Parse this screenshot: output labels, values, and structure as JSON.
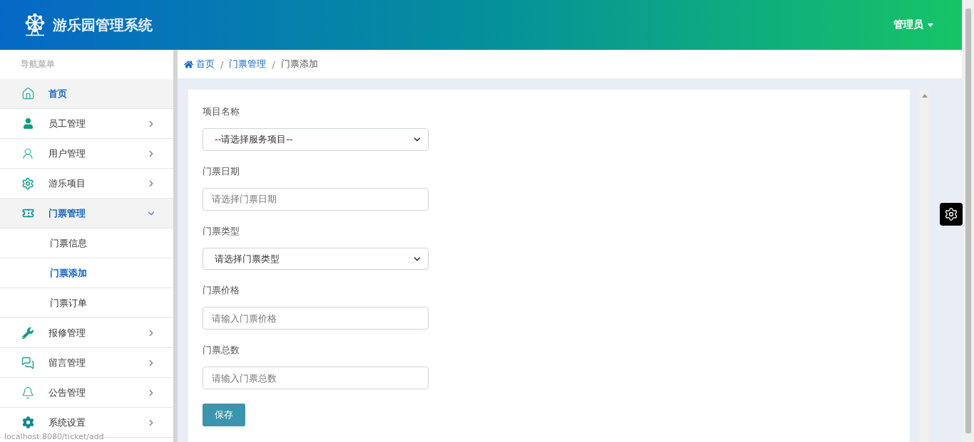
{
  "header": {
    "title": "游乐园管理系统",
    "user_menu": "管理员"
  },
  "sidebar": {
    "heading": "导航菜单",
    "items": [
      {
        "label": "首页",
        "selected": true,
        "expandable": false,
        "expanded": false
      },
      {
        "label": "员工管理",
        "selected": false,
        "expandable": true,
        "expanded": false
      },
      {
        "label": "用户管理",
        "selected": false,
        "expandable": true,
        "expanded": false
      },
      {
        "label": "游乐项目",
        "selected": false,
        "expandable": true,
        "expanded": false
      },
      {
        "label": "门票管理",
        "selected": true,
        "expandable": true,
        "expanded": true,
        "children": [
          {
            "label": "门票信息",
            "selected": false
          },
          {
            "label": "门票添加",
            "selected": true
          },
          {
            "label": "门票订单",
            "selected": false
          }
        ]
      },
      {
        "label": "报修管理",
        "selected": false,
        "expandable": true,
        "expanded": false
      },
      {
        "label": "留言管理",
        "selected": false,
        "expandable": true,
        "expanded": false
      },
      {
        "label": "公告管理",
        "selected": false,
        "expandable": true,
        "expanded": false
      },
      {
        "label": "系统设置",
        "selected": false,
        "expandable": true,
        "expanded": false
      }
    ]
  },
  "status_url": "localhost:8080/ticket/add",
  "breadcrumb": [
    {
      "label": "首页",
      "link": true
    },
    {
      "separator": "/",
      "label": "门票管理",
      "link": true
    },
    {
      "separator": "/",
      "label": "门票添加",
      "link": false
    }
  ],
  "form": {
    "fields": [
      {
        "kind": "select",
        "label": "项目名称",
        "value": "--请选择服务项目--"
      },
      {
        "kind": "input",
        "label": "门票日期",
        "placeholder": "请选择门票日期"
      },
      {
        "kind": "select",
        "label": "门票类型",
        "value": "请选择门票类型"
      },
      {
        "kind": "input",
        "label": "门票价格",
        "placeholder": "请输入门票价格"
      },
      {
        "kind": "input",
        "label": "门票总数",
        "placeholder": "请输入门票总数"
      }
    ],
    "submit": "保存"
  }
}
